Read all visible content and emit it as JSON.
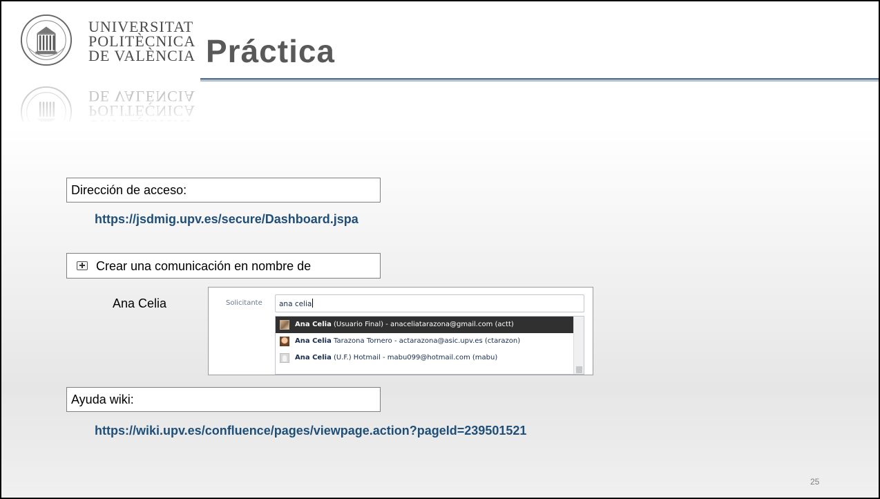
{
  "logo": {
    "university": [
      "UNIVERSITAT",
      "POLITÈCNICA",
      "DE VALÈNCIA"
    ]
  },
  "title": "Práctica",
  "access": {
    "label": "Dirección de acceso:",
    "url": "https://jsdmig.upv.es/secure/Dashboard.jspa"
  },
  "create_button": {
    "label": "Crear una comunicación en nombre de",
    "icon": "plus-box-icon"
  },
  "requester": {
    "name_label": "Ana Celia",
    "field_label": "Solicitante",
    "input_value": "ana celia",
    "options": [
      {
        "bold": "Ana Celia",
        "rest": " (Usuario Final) - anaceliatarazona@gmail.com (actt)",
        "selected": true,
        "icon": "user-avatar-icon"
      },
      {
        "bold": "Ana Celia",
        "rest": " Tarazona Tornero - actarazona@asic.upv.es (ctarazon)",
        "selected": false,
        "icon": "user-avatar-icon"
      },
      {
        "bold": "Ana Celia",
        "rest": " (U.F.) Hotmail - mabu099@hotmail.com (mabu)",
        "selected": false,
        "icon": "default-avatar-icon"
      }
    ]
  },
  "help": {
    "label": "Ayuda wiki:",
    "url": "https://wiki.upv.es/confluence/pages/viewpage.action?pageId=239501521"
  },
  "page_number": "25",
  "colors": {
    "title": "#595959",
    "link": "#1f4e79",
    "rule": "#4f6b8a",
    "selected_option_bg": "#303030"
  }
}
